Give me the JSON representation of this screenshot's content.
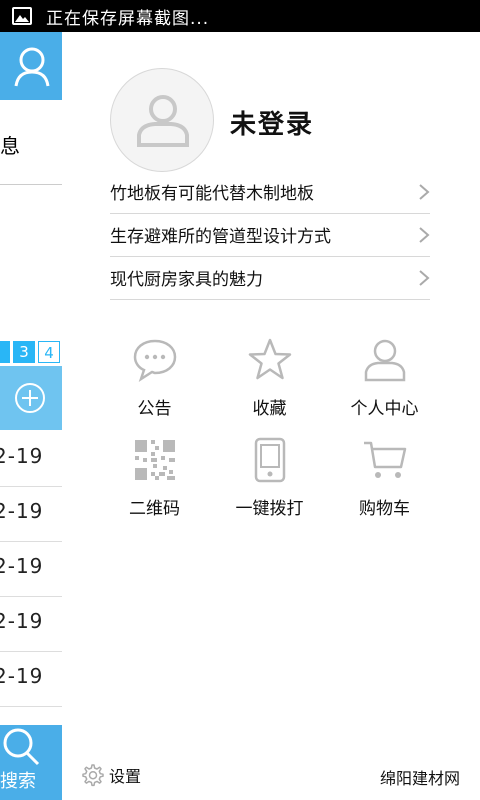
{
  "statusbar": {
    "text": "正在保存屏幕截图..."
  },
  "background_page": {
    "info_label": "息",
    "pager": [
      "3",
      "4"
    ],
    "dates": [
      "2-19",
      "2-19",
      "2-19",
      "2-19",
      "2-19"
    ],
    "search_label": "搜索"
  },
  "menu": {
    "username": "未登录",
    "news": [
      {
        "title": "竹地板有可能代替木制地板"
      },
      {
        "title": "生存避难所的管道型设计方式"
      },
      {
        "title": "现代厨房家具的魅力"
      }
    ],
    "grid": [
      {
        "label": "公告",
        "icon": "chat-bubble-icon"
      },
      {
        "label": "收藏",
        "icon": "star-icon"
      },
      {
        "label": "个人中心",
        "icon": "person-icon"
      },
      {
        "label": "二维码",
        "icon": "qr-code-icon"
      },
      {
        "label": "一键拨打",
        "icon": "phone-icon"
      },
      {
        "label": "购物车",
        "icon": "cart-icon"
      }
    ],
    "settings_label": "设置",
    "brand": "绵阳建材网"
  },
  "colors": {
    "accent": "#4aaee8",
    "icon_gray": "#b9b9b9"
  }
}
